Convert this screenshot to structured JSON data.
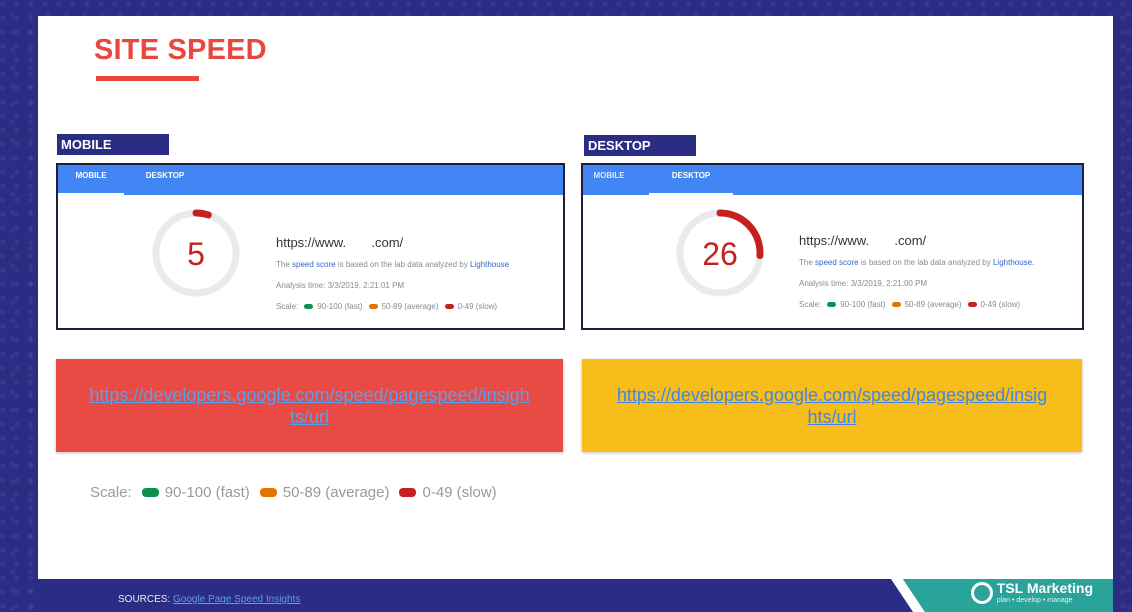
{
  "slide": {
    "title": "SITE SPEED"
  },
  "mobile": {
    "section_label": "MOBILE",
    "tabs": [
      {
        "label": "MOBILE",
        "active": true
      },
      {
        "label": "DESKTOP",
        "active": false
      }
    ],
    "score": "5",
    "score_fraction": 0.05,
    "score_color": "#c5221f",
    "url_prefix": "https://www.",
    "url_suffix": ".com/",
    "desc_pre": "The",
    "desc_link": "speed score",
    "desc_mid": "is based on the lab data analyzed by",
    "desc_link2": "Lighthouse",
    "analysis_time": "Analysis time: 3/3/2019, 2:21:01 PM",
    "banner_link": "https://developers.google.com/speed/pagespeed/insights/url",
    "banner_line1": "https://developers.google.com/speed/pagespeed/insigh",
    "banner_line2": "ts/url",
    "banner_color": "#e94b44"
  },
  "desktop": {
    "section_label": "DESKTOP",
    "tabs": [
      {
        "label": "MOBILE",
        "active": false
      },
      {
        "label": "DESKTOP",
        "active": true
      }
    ],
    "score": "26",
    "score_fraction": 0.26,
    "score_color": "#c5221f",
    "url_prefix": "https://www.",
    "url_suffix": ".com/",
    "desc_pre": "The",
    "desc_link": "speed score",
    "desc_mid": "is based on the lab data analyzed by",
    "desc_link2": "Lighthouse.",
    "analysis_time": "Analysis time: 3/3/2019, 2:21:00 PM",
    "banner_link": "https://developers.google.com/speed/pagespeed/insights/url",
    "banner_line1": "https://developers.google.com/speed/pagespeed/insig",
    "banner_line2": "hts/url",
    "banner_color": "#f7bd1a"
  },
  "scale": {
    "label": "Scale:",
    "items": [
      {
        "text": "90-100 (fast)",
        "color": "#0d904f"
      },
      {
        "text": "50-89 (average)",
        "color": "#e37400"
      },
      {
        "text": "0-49 (slow)",
        "color": "#c5221f"
      }
    ]
  },
  "footer": {
    "sources_label": "SOURCES:",
    "sources_link": "Google Page Speed Insights",
    "brand_name": "TSL Marketing",
    "brand_tagline": "plan • develop • manage",
    "bar_color": "#2a2d83",
    "accent_color": "#2aa39a"
  }
}
